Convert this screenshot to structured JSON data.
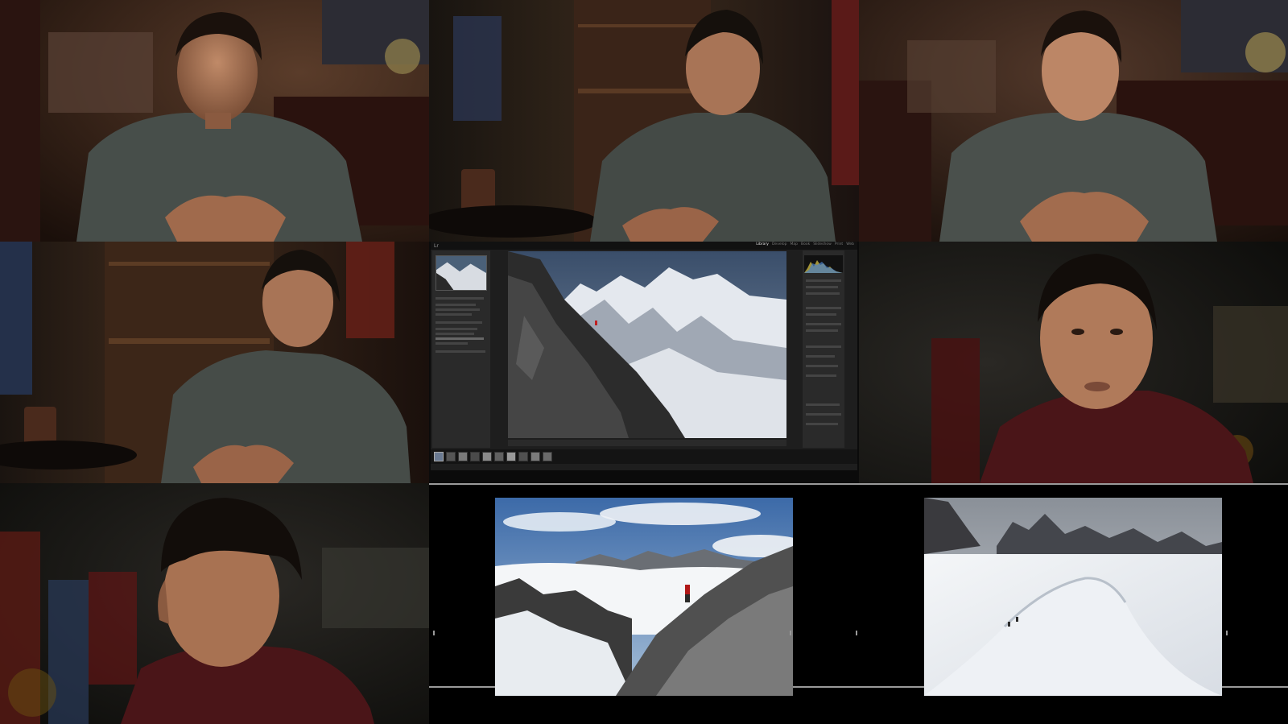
{
  "page": {
    "layout": "3x3 collage of video stills",
    "cells": [
      {
        "id": "still-1",
        "subject": "man in grey sweater speaking, hands clasped, warm living room"
      },
      {
        "id": "still-2",
        "subject": "man in grey sweater, eyes closed, bookshelf background"
      },
      {
        "id": "still-3",
        "subject": "man in grey sweater speaking, hands clasped"
      },
      {
        "id": "still-4",
        "subject": "man in grey sweater speaking, side angle"
      },
      {
        "id": "still-5",
        "subject": "photo editing application screenshot with alpine climbing image"
      },
      {
        "id": "still-6",
        "subject": "close-up of man in dark red sweater"
      },
      {
        "id": "still-7",
        "subject": "profile of man in dark red sweater"
      },
      {
        "id": "still-8",
        "subject": "two mountain photographs side by side"
      }
    ]
  },
  "lightroom": {
    "logo": "Lr",
    "modules": [
      "Library",
      "Develop",
      "Map",
      "Book",
      "Slideshow",
      "Print",
      "Web"
    ],
    "active_module": "Library"
  },
  "colors": {
    "room_warm": "#3a2418",
    "sweater_grey": "#4a504c",
    "sweater_red": "#4a1518",
    "skin": "#b07a5a",
    "lr_bg": "#1e1e1e"
  }
}
